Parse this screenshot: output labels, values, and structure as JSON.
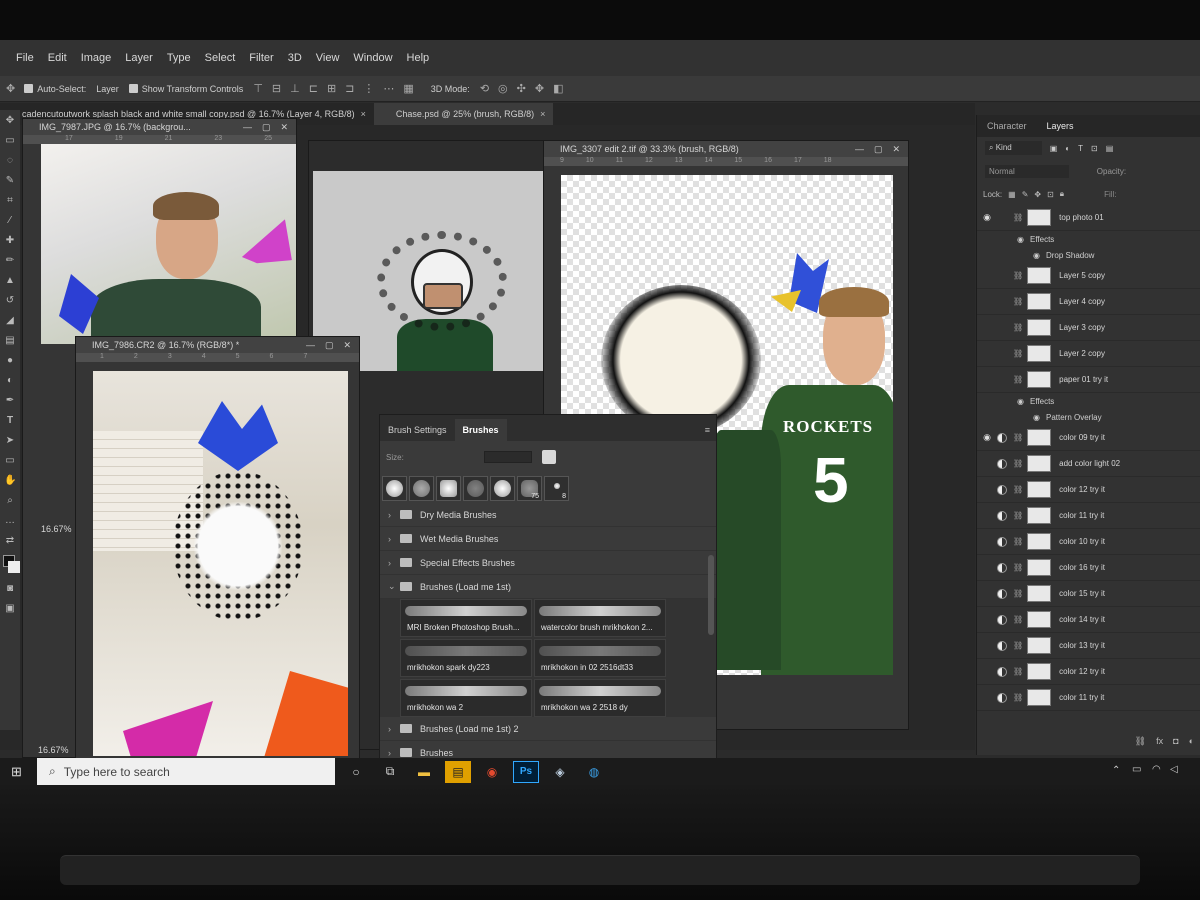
{
  "menu": [
    "File",
    "Edit",
    "Image",
    "Layer",
    "Type",
    "Select",
    "Filter",
    "3D",
    "View",
    "Window",
    "Help"
  ],
  "options": {
    "auto_select": "Auto-Select:",
    "layer_dropdown": "Layer",
    "show_transform": "Show Transform Controls",
    "mode_3d": "3D Mode:"
  },
  "doc_tabs": [
    {
      "label": "cadencutoutwork splash black and white small copy.psd @ 16.7% (Layer 4, RGB/8)",
      "close": "×"
    },
    {
      "label": "Chase.psd @ 25% (brush, RGB/8)",
      "close": "×"
    }
  ],
  "windows": {
    "w1": {
      "title": "IMG_7987.JPG @ 16.7% (backgrou..."
    },
    "w2": {
      "title": "IMG_7986.CR2 @ 16.7% (RGB/8*) *",
      "zoom": "16.67%"
    },
    "w3": {
      "title": "IMG_3307 edit 2.tif @ 33.3% (brush, RGB/8)"
    },
    "w1_zoom": "16.67%"
  },
  "rulers": {
    "w1": [
      "17",
      "19",
      "21",
      "23",
      "25"
    ],
    "w2": [
      "1",
      "2",
      "3",
      "4",
      "5",
      "6",
      "7"
    ],
    "w3": [
      "9",
      "10",
      "11",
      "12",
      "13",
      "14",
      "15",
      "16",
      "17",
      "18"
    ]
  },
  "brush_panel": {
    "tabs": [
      "Brush Settings",
      "Brushes"
    ],
    "size_label": "Size:",
    "preset_nums": [
      "75",
      "8"
    ],
    "folders_top": [
      "Dry Media Brushes",
      "Wet Media Brushes",
      "Special Effects Brushes",
      "Brushes (Load me 1st)"
    ],
    "brushes": [
      "MRI Broken Photoshop Brush...",
      "watercolor brush mrikhokon 2...",
      "mrikhokon spark dy223",
      "mrikhokon in 02 2516dt33",
      "mrikhokon wa 2",
      "mrikhokon wa 2 2518 dy"
    ],
    "folders_bottom": [
      "Brushes (Load me 1st) 2",
      "Brushes"
    ]
  },
  "layers": {
    "tabs": [
      "Character",
      "Layers"
    ],
    "kind": "Kind",
    "blend": "Normal",
    "opacity": "Opacity:",
    "lock": "Lock:",
    "fill": "Fill:",
    "rows": [
      {
        "name": "top photo 01",
        "type": "thumb",
        "visible": true
      },
      {
        "fx": "Effects"
      },
      {
        "fx": "Drop Shadow"
      },
      {
        "name": "Layer 5 copy",
        "type": "thumb",
        "visible": false
      },
      {
        "name": "Layer 4 copy",
        "type": "thumb",
        "visible": false
      },
      {
        "name": "Layer 3 copy",
        "type": "thumb",
        "visible": false
      },
      {
        "name": "Layer 2 copy",
        "type": "thumb",
        "visible": false
      },
      {
        "name": "paper 01 try it",
        "type": "thumb",
        "visible": false
      },
      {
        "fx": "Effects"
      },
      {
        "fx": "Pattern Overlay"
      },
      {
        "name": "color 09 try it",
        "type": "adj",
        "visible": true
      },
      {
        "name": "add color light 02",
        "type": "adj",
        "visible": false
      },
      {
        "name": "color 12 try it",
        "type": "adj",
        "visible": false
      },
      {
        "name": "color 11 try it",
        "type": "adj",
        "visible": false
      },
      {
        "name": "color 10 try it",
        "type": "adj",
        "visible": false
      },
      {
        "name": "color 16 try it",
        "type": "adj",
        "visible": false
      },
      {
        "name": "color 15 try it",
        "type": "adj",
        "visible": false
      },
      {
        "name": "color 14 try it",
        "type": "adj",
        "visible": false
      },
      {
        "name": "color 13 try it",
        "type": "adj",
        "visible": false
      },
      {
        "name": "color 12 try it",
        "type": "adj",
        "visible": false
      },
      {
        "name": "color 11 try it",
        "type": "adj",
        "visible": false
      }
    ]
  },
  "jersey": {
    "team": "ROCKETS",
    "number": "5"
  },
  "taskbar": {
    "search_placeholder": "Type here to search",
    "ps": "Ps"
  },
  "colors": {
    "ps_blue": "#31a8ff",
    "jersey_green": "#2f5a2c"
  }
}
